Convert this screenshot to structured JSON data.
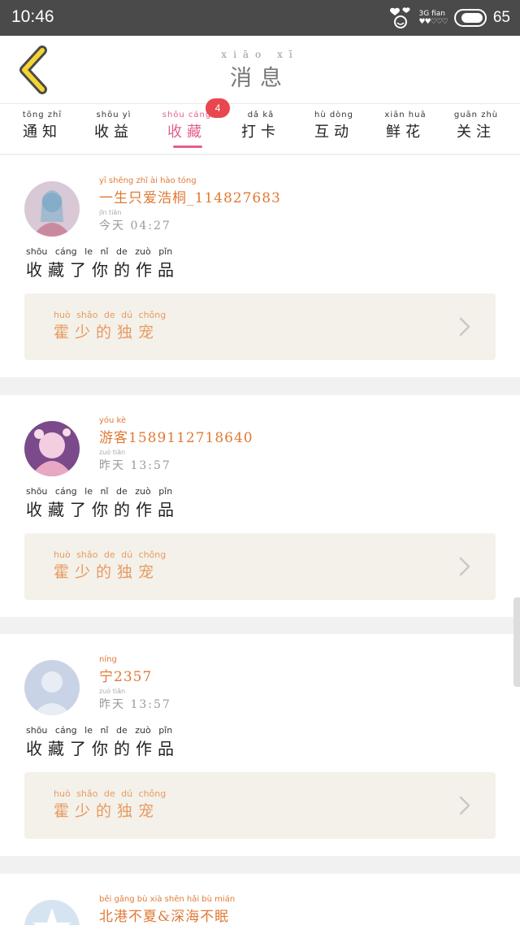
{
  "status_bar": {
    "time": "10:46",
    "network": "3G",
    "network_sub": "fian",
    "battery": "65"
  },
  "header": {
    "title_pinyin": "xiāo xī",
    "title": "消息"
  },
  "tabs": [
    {
      "pinyin": "tōng zhī",
      "label": "通知"
    },
    {
      "pinyin": "shōu yì",
      "label": "收益"
    },
    {
      "pinyin": "shōu cáng",
      "label": "收藏",
      "active": true,
      "badge": "4"
    },
    {
      "pinyin": "dǎ kǎ",
      "label": "打卡"
    },
    {
      "pinyin": "hù dòng",
      "label": "互动"
    },
    {
      "pinyin": "xiān huā",
      "label": "鲜花"
    },
    {
      "pinyin": "guān zhù",
      "label": "关注"
    }
  ],
  "messages": [
    {
      "name_pinyin": "yī shēng zhǐ ài hào tóng",
      "name": "一生只爱浩桐_114827683",
      "time_pinyin": "jīn tiān",
      "time": "今天 04:27",
      "action_pinyin": "shōu cáng le nǐ de zuò pǐn",
      "action": "收藏了你的作品",
      "work_pinyin": "huò shǎo de dú chǒng",
      "work": "霍少的独宠",
      "avatar_colors": [
        "#d9c8d6",
        "#8aa8c8",
        "#c98aa0"
      ]
    },
    {
      "name_pinyin": "yóu kè",
      "name": "游客1589112718640",
      "time_pinyin": "zuó tiān",
      "time": "昨天 13:57",
      "action_pinyin": "shōu cáng le nǐ de zuò pǐn",
      "action": "收藏了你的作品",
      "work_pinyin": "huò shǎo de dú chǒng",
      "work": "霍少的独宠",
      "avatar_colors": [
        "#f3cde0",
        "#7a4a8a",
        "#e8a8c4"
      ]
    },
    {
      "name_pinyin": "níng",
      "name": "宁2357",
      "time_pinyin": "zuó tiān",
      "time": "昨天 13:57",
      "action_pinyin": "shōu cáng le nǐ de zuò pǐn",
      "action": "收藏了你的作品",
      "work_pinyin": "huò shǎo de dú chǒng",
      "work": "霍少的独宠",
      "avatar_colors": [
        "#c9d3e6",
        "#e8edf5",
        "#b4c1db"
      ]
    },
    {
      "name_pinyin": "běi gǎng bù xià shēn hǎi bù mián",
      "name": "北港不夏&深海不眠",
      "avatar_colors": [
        "#d6e4f2",
        "#ffffff",
        "#b9cde4"
      ]
    }
  ],
  "colors": {
    "accent_pink": "#e35f8e",
    "name_orange": "#e07a36",
    "work_orange": "#e89a61",
    "badge_red": "#e8474f"
  }
}
